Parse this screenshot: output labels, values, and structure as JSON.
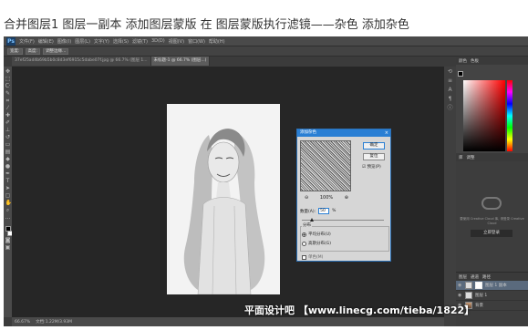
{
  "caption": "合并图层1 图层一副本 添加图层蒙版 在 图层蒙版执行滤镜——杂色 添加杂色",
  "app": {
    "logo": "Ps",
    "menu": [
      "文件(F)",
      "编辑(E)",
      "图像(I)",
      "图层(L)",
      "文字(Y)",
      "选择(S)",
      "滤镜(T)",
      "3D(D)",
      "视图(V)",
      "窗口(W)",
      "帮助(H)"
    ],
    "options": [
      "宽度:",
      "高度:",
      "调整边缘..."
    ],
    "doc_tabs": [
      {
        "label": "37ef25ad4b69b5b0c8d3ef6915c5dabe07f.jpg @ 66.7% (图层 1...",
        "active": false
      },
      {
        "label": "未标题-1 @ 66.7% (图层...)",
        "active": true
      }
    ],
    "status": {
      "zoom": "66.67%",
      "doc": "文档:1.22M/3.93M"
    }
  },
  "panels": {
    "tabs": [
      "颜色",
      "色板"
    ],
    "library_tabs": [
      "库",
      "调整"
    ],
    "library_text": "要使用 Creative Cloud 库, 请登录 Creative Cloud",
    "library_button": "立即登录",
    "layers_tabs": [
      "图层",
      "通道",
      "路径"
    ],
    "layers": [
      {
        "name": "图层 1 副本",
        "active": true,
        "has_mask": true
      },
      {
        "name": "图层 1",
        "active": false,
        "has_mask": false
      },
      {
        "name": "背景",
        "active": false,
        "has_mask": false
      }
    ]
  },
  "dialog": {
    "title": "添加杂色",
    "ok": "确定",
    "reset": "复位",
    "preview_label": "预览(P)",
    "zoom": "100%",
    "amount_label": "数量(A):",
    "amount_value": "50",
    "amount_unit": "%",
    "distribution_label": "分布",
    "radio_uniform": "平均分布(U)",
    "radio_gaussian": "高斯分布(G)",
    "uniform_selected": true,
    "mono_label": "单色(M)"
  },
  "watermark": "平面设计吧 【www.linecg.com/tieba/1822】",
  "colors": {
    "accent": "#2a7fd4",
    "workspace": "#262626",
    "panel": "#444444"
  }
}
